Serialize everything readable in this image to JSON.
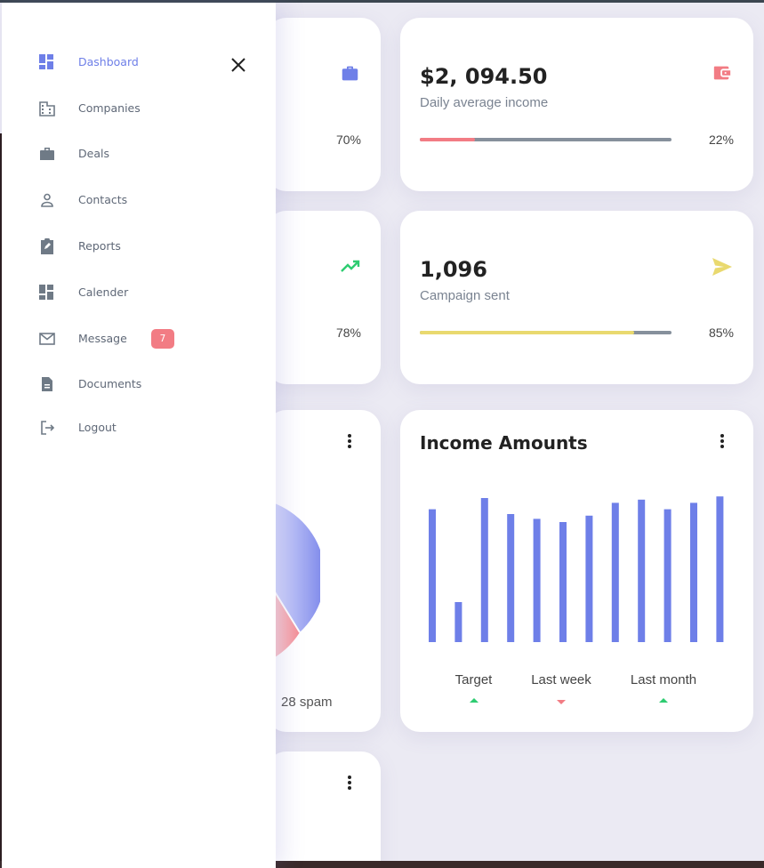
{
  "sidebar": {
    "items": [
      {
        "label": "Dashboard",
        "icon": "dashboard-icon"
      },
      {
        "label": "Companies",
        "icon": "building-icon"
      },
      {
        "label": "Deals",
        "icon": "briefcase-icon"
      },
      {
        "label": "Contacts",
        "icon": "person-icon"
      },
      {
        "label": "Reports",
        "icon": "clipboard-icon"
      },
      {
        "label": "Calender",
        "icon": "calendar-grid-icon"
      },
      {
        "label": "Message",
        "icon": "mail-icon",
        "badge": "7"
      },
      {
        "label": "Documents",
        "icon": "document-icon"
      },
      {
        "label": "Logout",
        "icon": "logout-icon"
      }
    ],
    "active_item": "Dashboard",
    "close_icon": "close-icon"
  },
  "cards": {
    "left_top": {
      "percent": "70%",
      "progress": 0.7,
      "icon": "briefcase-icon",
      "accent": "#6e7fe8"
    },
    "daily_income": {
      "value": "$2, 094.50",
      "label": "Daily average income",
      "percent": "22%",
      "progress": 0.22,
      "icon": "wallet-icon",
      "accent": "#f27c84"
    },
    "left_middle": {
      "percent": "78%",
      "progress": 0.78,
      "icon": "trending-up-icon",
      "accent": "#2ecc71"
    },
    "campaign": {
      "value": "1,096",
      "label": "Campaign sent",
      "percent": "85%",
      "progress": 0.85,
      "icon": "send-icon",
      "accent": "#e9d96f"
    },
    "pie_card": {
      "legend_text": "28 spam"
    }
  },
  "colors": {
    "primary": "#6e7fe8",
    "danger": "#f27c84",
    "success": "#2ecc71",
    "warning": "#e9d96f",
    "track": "#86909c"
  },
  "chart_data": {
    "type": "bar",
    "title": "Income Amounts",
    "values": [
      83,
      25,
      90,
      80,
      77,
      75,
      79,
      87,
      89,
      83,
      87,
      91
    ],
    "ylim": [
      0,
      100
    ],
    "legend": [
      {
        "label": "Target",
        "trend": "up",
        "color": "#2ecc71"
      },
      {
        "label": "Last week",
        "trend": "down",
        "color": "#f27c84"
      },
      {
        "label": "Last month",
        "trend": "up",
        "color": "#2ecc71"
      }
    ]
  }
}
